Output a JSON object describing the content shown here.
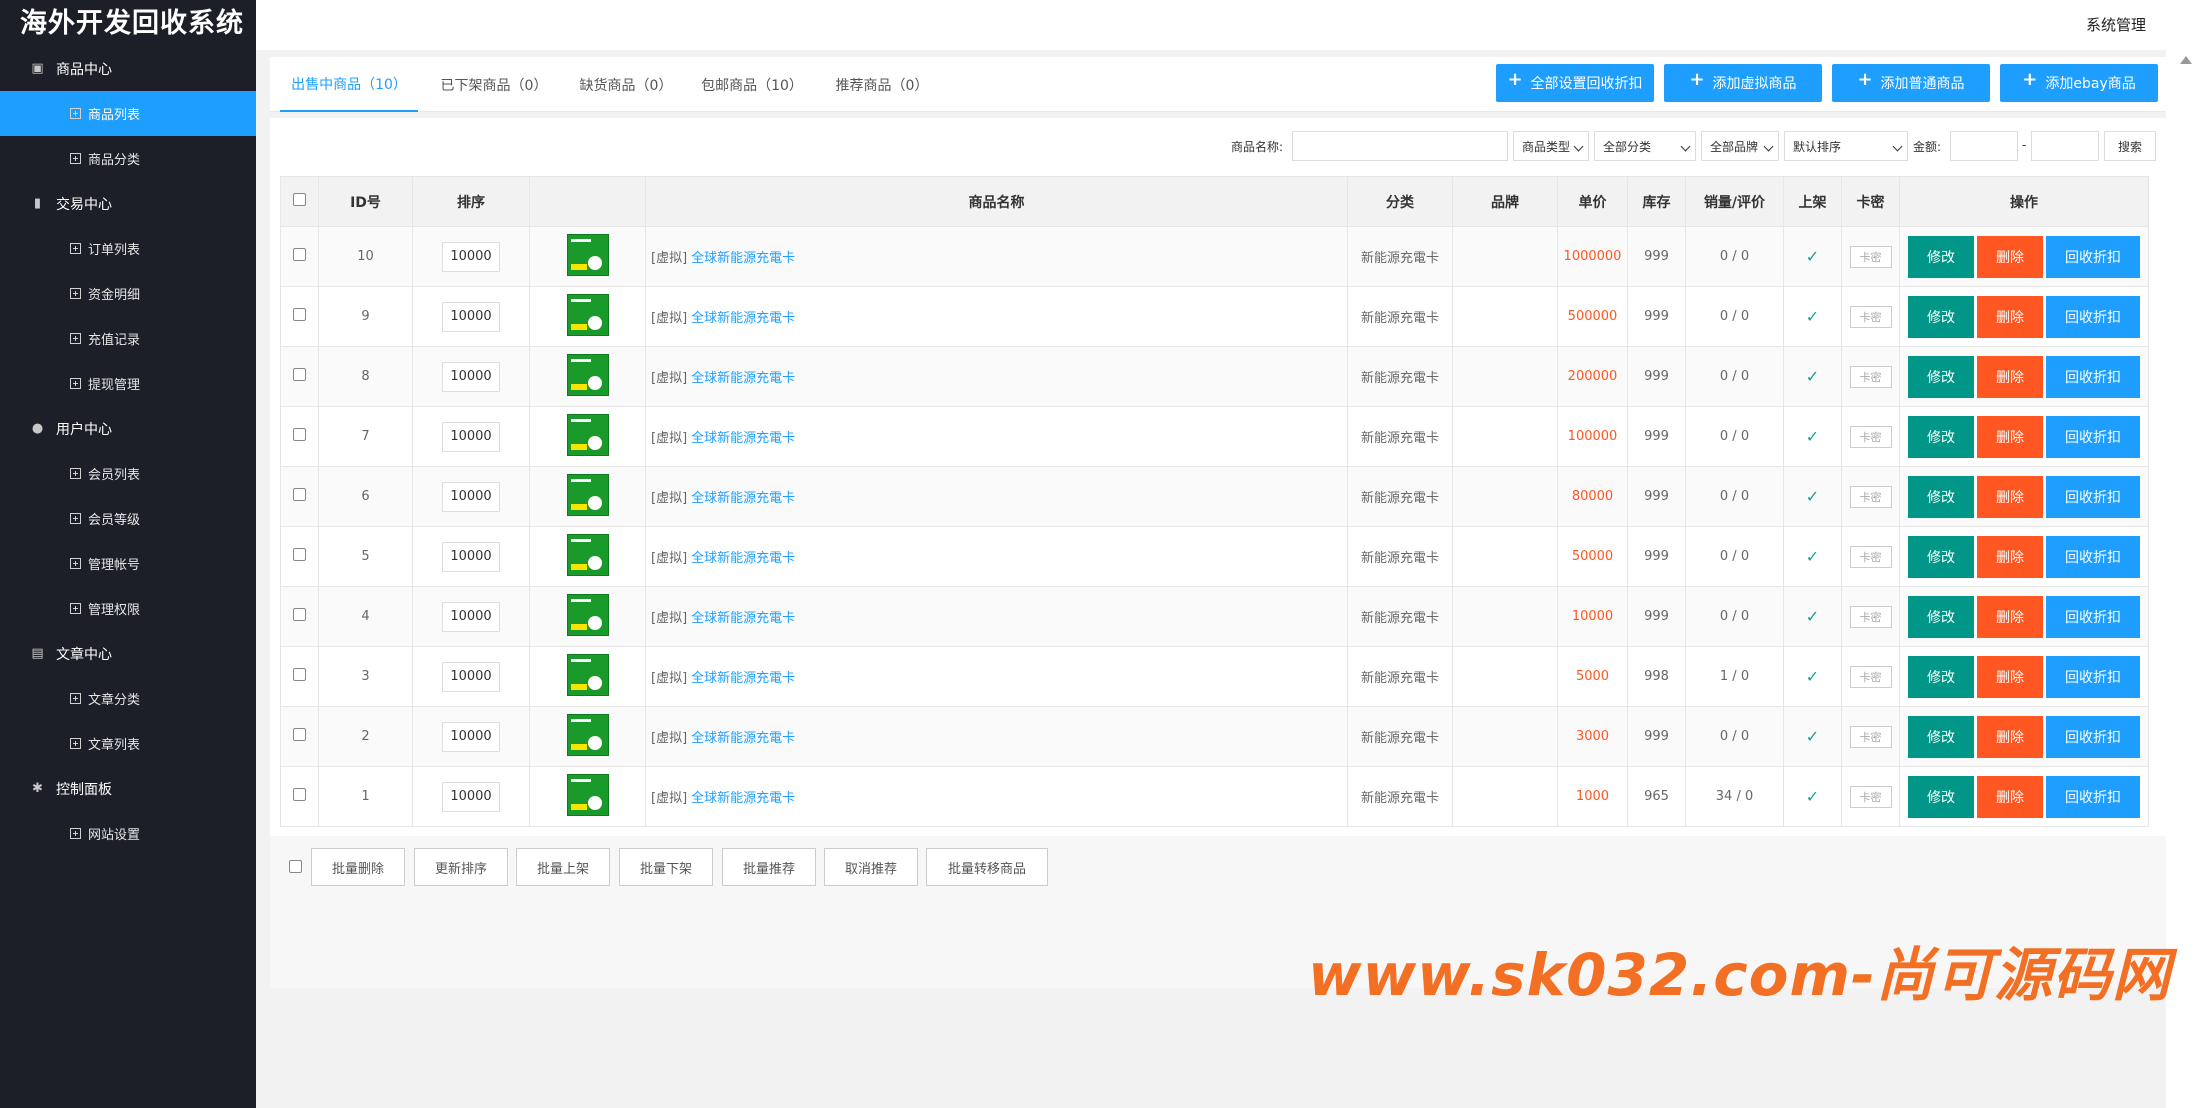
{
  "app": {
    "logo": "海外开发回收系统",
    "system_menu": "系统管理"
  },
  "sidebar": {
    "groups": [
      {
        "label": "商品中心",
        "icon": "box-icon",
        "items": [
          {
            "label": "商品列表",
            "active": true
          },
          {
            "label": "商品分类"
          }
        ]
      },
      {
        "label": "交易中心",
        "icon": "bar-chart-icon",
        "items": [
          {
            "label": "订单列表"
          },
          {
            "label": "资金明细"
          },
          {
            "label": "充值记录"
          },
          {
            "label": "提现管理"
          }
        ]
      },
      {
        "label": "用户中心",
        "icon": "user-icon",
        "items": [
          {
            "label": "会员列表"
          },
          {
            "label": "会员等级"
          },
          {
            "label": "管理帐号"
          },
          {
            "label": "管理权限"
          }
        ]
      },
      {
        "label": "文章中心",
        "icon": "document-icon",
        "items": [
          {
            "label": "文章分类"
          },
          {
            "label": "文章列表"
          }
        ]
      },
      {
        "label": "控制面板",
        "icon": "gear-icon",
        "items": [
          {
            "label": "网站设置"
          }
        ]
      }
    ]
  },
  "tabs": [
    {
      "label": "出售中商品（10）",
      "active": true
    },
    {
      "label": "已下架商品（0）"
    },
    {
      "label": "缺货商品（0）"
    },
    {
      "label": "包邮商品（10）"
    },
    {
      "label": "推荐商品（0）"
    }
  ],
  "top_buttons": [
    "全部设置回收折扣",
    "添加虚拟商品",
    "添加普通商品",
    "添加ebay商品"
  ],
  "filters": {
    "name_label": "商品名称:",
    "type_select": "商品类型",
    "category_select": "全部分类",
    "brand_select": "全部品牌",
    "sort_select": "默认排序",
    "amount_label": "金额:",
    "range_sep": "-",
    "search_button": "搜索"
  },
  "table": {
    "headers": [
      "ID号",
      "排序",
      "商品名称",
      "分类",
      "品牌",
      "单价",
      "库存",
      "销量/评价",
      "上架",
      "卡密",
      "操作"
    ],
    "rows": [
      {
        "id": "10",
        "sort": "10000",
        "tag": "[虚拟]",
        "name": "全球新能源充電卡",
        "category": "新能源充電卡",
        "brand": "",
        "price": "1000000",
        "stock": "999",
        "sales": "0 / 0"
      },
      {
        "id": "9",
        "sort": "10000",
        "tag": "[虚拟]",
        "name": "全球新能源充電卡",
        "category": "新能源充電卡",
        "brand": "",
        "price": "500000",
        "stock": "999",
        "sales": "0 / 0"
      },
      {
        "id": "8",
        "sort": "10000",
        "tag": "[虚拟]",
        "name": "全球新能源充電卡",
        "category": "新能源充電卡",
        "brand": "",
        "price": "200000",
        "stock": "999",
        "sales": "0 / 0"
      },
      {
        "id": "7",
        "sort": "10000",
        "tag": "[虚拟]",
        "name": "全球新能源充電卡",
        "category": "新能源充電卡",
        "brand": "",
        "price": "100000",
        "stock": "999",
        "sales": "0 / 0"
      },
      {
        "id": "6",
        "sort": "10000",
        "tag": "[虚拟]",
        "name": "全球新能源充電卡",
        "category": "新能源充電卡",
        "brand": "",
        "price": "80000",
        "stock": "999",
        "sales": "0 / 0"
      },
      {
        "id": "5",
        "sort": "10000",
        "tag": "[虚拟]",
        "name": "全球新能源充電卡",
        "category": "新能源充電卡",
        "brand": "",
        "price": "50000",
        "stock": "999",
        "sales": "0 / 0"
      },
      {
        "id": "4",
        "sort": "10000",
        "tag": "[虚拟]",
        "name": "全球新能源充電卡",
        "category": "新能源充電卡",
        "brand": "",
        "price": "10000",
        "stock": "999",
        "sales": "0 / 0"
      },
      {
        "id": "3",
        "sort": "10000",
        "tag": "[虚拟]",
        "name": "全球新能源充電卡",
        "category": "新能源充電卡",
        "brand": "",
        "price": "5000",
        "stock": "998",
        "sales": "1 / 0"
      },
      {
        "id": "2",
        "sort": "10000",
        "tag": "[虚拟]",
        "name": "全球新能源充電卡",
        "category": "新能源充電卡",
        "brand": "",
        "price": "3000",
        "stock": "999",
        "sales": "0 / 0"
      },
      {
        "id": "1",
        "sort": "10000",
        "tag": "[虚拟]",
        "name": "全球新能源充電卡",
        "category": "新能源充電卡",
        "brand": "",
        "price": "1000",
        "stock": "965",
        "sales": "34 / 0"
      }
    ],
    "check_mark": "✓",
    "kami_label": "卡密",
    "actions": {
      "edit": "修改",
      "delete": "删除",
      "recycle": "回收折扣"
    }
  },
  "bulk_buttons": [
    "批量删除",
    "更新排序",
    "批量上架",
    "批量下架",
    "批量推荐",
    "取消推荐",
    "批量转移商品"
  ],
  "watermark": "www.sk032.com-尚可源码网",
  "colors": {
    "sidebar_bg": "#1c1f27",
    "accent": "#1e9fff",
    "edit": "#009688",
    "danger": "#ff5722",
    "price": "#ff5722",
    "check": "#1aa094",
    "watermark": "#f26f23"
  }
}
